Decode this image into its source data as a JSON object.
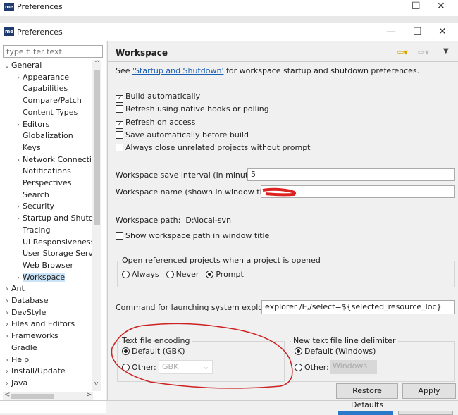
{
  "outer_window": {
    "title": "Preferences"
  },
  "window": {
    "title": "Preferences",
    "minimize": "—",
    "maximize": "☐",
    "close": "✕"
  },
  "filter": {
    "placeholder": "type filter text"
  },
  "tree": [
    {
      "label": "General",
      "level": 0,
      "expanded": true
    },
    {
      "label": "Appearance",
      "level": 1,
      "expandable": true
    },
    {
      "label": "Capabilities",
      "level": 1
    },
    {
      "label": "Compare/Patch",
      "level": 1
    },
    {
      "label": "Content Types",
      "level": 1
    },
    {
      "label": "Editors",
      "level": 1,
      "expandable": true
    },
    {
      "label": "Globalization",
      "level": 1
    },
    {
      "label": "Keys",
      "level": 1
    },
    {
      "label": "Network Connecti",
      "level": 1,
      "expandable": true
    },
    {
      "label": "Notifications",
      "level": 1
    },
    {
      "label": "Perspectives",
      "level": 1
    },
    {
      "label": "Search",
      "level": 1
    },
    {
      "label": "Security",
      "level": 1,
      "expandable": true
    },
    {
      "label": "Startup and Shutd",
      "level": 1,
      "expandable": true
    },
    {
      "label": "Tracing",
      "level": 1
    },
    {
      "label": "UI Responsiveness",
      "level": 1
    },
    {
      "label": "User Storage Serv",
      "level": 1
    },
    {
      "label": "Web Browser",
      "level": 1
    },
    {
      "label": "Workspace",
      "level": 1,
      "expandable": true,
      "selected": true
    },
    {
      "label": "Ant",
      "level": 0,
      "expandable": true
    },
    {
      "label": "Database",
      "level": 0,
      "expandable": true
    },
    {
      "label": "DevStyle",
      "level": 0,
      "expandable": true
    },
    {
      "label": "Files and Editors",
      "level": 0,
      "expandable": true
    },
    {
      "label": "Frameworks",
      "level": 0,
      "expandable": true
    },
    {
      "label": "Gradle",
      "level": 0
    },
    {
      "label": "Help",
      "level": 0,
      "expandable": true
    },
    {
      "label": "Install/Update",
      "level": 0,
      "expandable": true
    },
    {
      "label": "Java",
      "level": 0,
      "expandable": true
    }
  ],
  "page": {
    "title": "Workspace",
    "see_prefix": "See ",
    "see_link": "'Startup and Shutdown'",
    "see_suffix": " for workspace startup and shutdown preferences.",
    "checkboxes": [
      {
        "label": "Build automatically",
        "checked": true
      },
      {
        "label": "Refresh using native hooks or polling",
        "checked": false
      },
      {
        "label": "Refresh on access",
        "checked": true
      },
      {
        "label": "Save automatically before build",
        "checked": false
      },
      {
        "label": "Always close unrelated projects without prompt",
        "checked": false
      }
    ],
    "save_interval_label": "Workspace save interval (in minutes):",
    "save_interval_value": "5",
    "ws_name_label": "Workspace name (shown in window title):",
    "ws_path_label": "Workspace path:",
    "ws_path_value": "D:\\local-svn",
    "show_path_label": "Show workspace path in window title",
    "open_ref_label": "Open referenced projects when a project is opened",
    "open_ref_options": [
      "Always",
      "Never",
      "Prompt"
    ],
    "open_ref_selected": "Prompt",
    "cmd_label": "Command for launching system explorer:",
    "cmd_value": "explorer /E,/select=${selected_resource_loc}",
    "encoding": {
      "label": "Text file encoding",
      "default": "Default (GBK)",
      "other": "Other:",
      "other_value": "GBK"
    },
    "delimiter": {
      "label": "New text file line delimiter",
      "default": "Default (Windows)",
      "other": "Other:",
      "other_value": "Windows"
    },
    "restore_defaults": "Restore Defaults",
    "apply": "Apply"
  },
  "colors": {
    "annotation": "#cc2222",
    "link": "#1a5fb4",
    "selection": "#cce4f7"
  }
}
